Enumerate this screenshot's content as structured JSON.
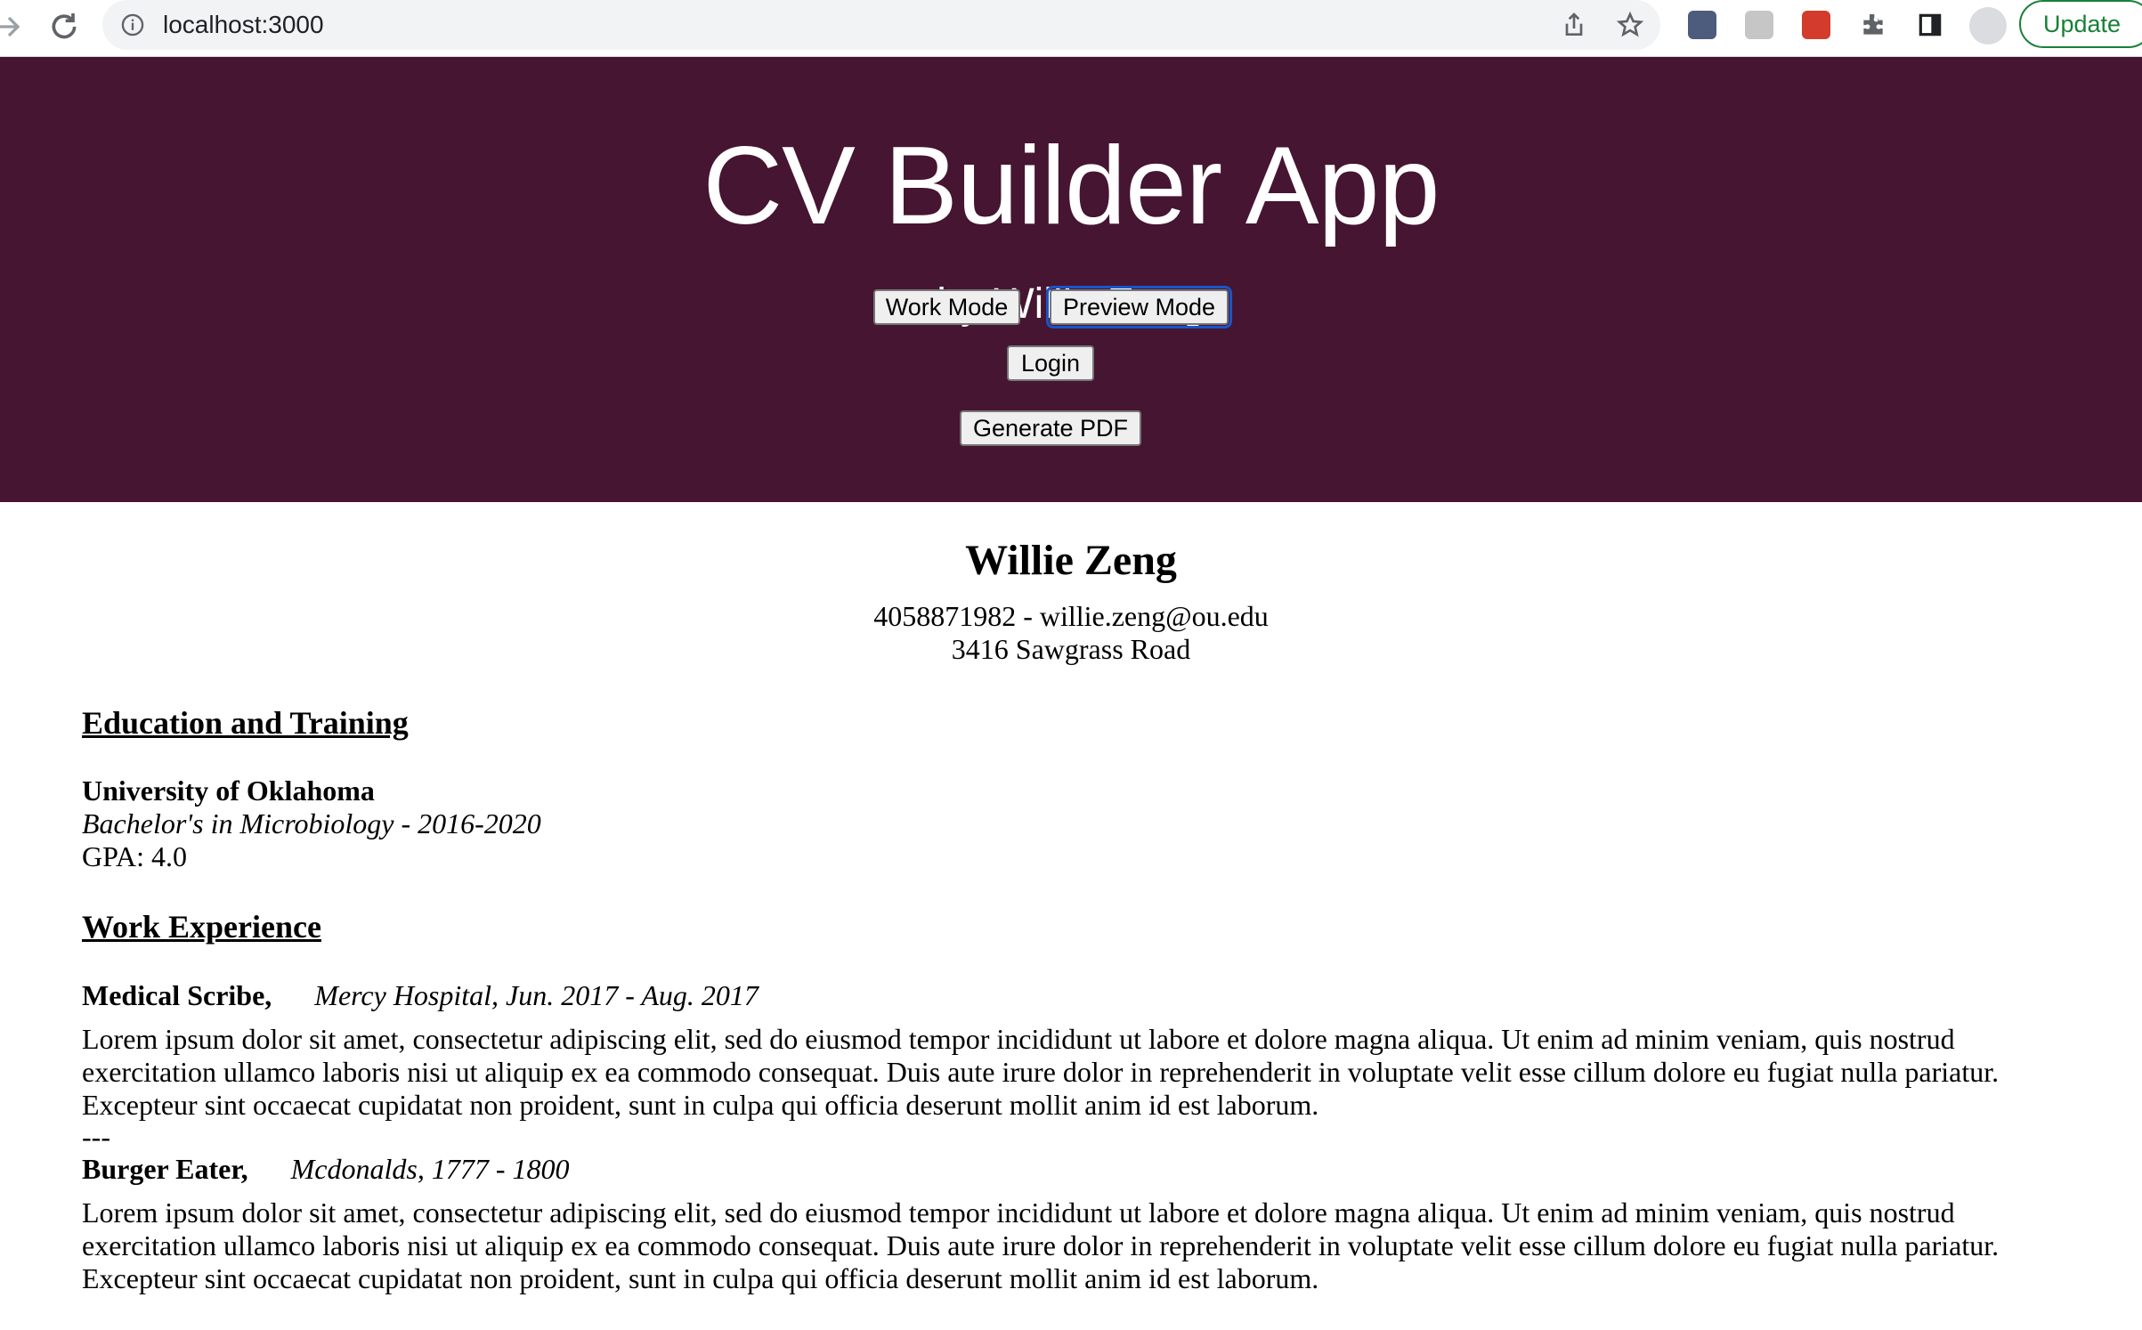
{
  "browser": {
    "url": "localhost:3000",
    "update_label": "Update",
    "accent": "#188038"
  },
  "app": {
    "header_color": "#461531",
    "title": "CV Builder App",
    "subtitle": "by Willie Zeng",
    "buttons": {
      "work_mode": "Work Mode",
      "preview_mode": "Preview Mode",
      "login": "Login",
      "generate_pdf": "Generate PDF"
    }
  },
  "resume": {
    "name": "Willie Zeng",
    "contact_line": "4058871982 - willie.zeng@ou.edu",
    "address": "3416 Sawgrass Road",
    "education": {
      "heading": "Education and Training",
      "school": "University of Oklahoma",
      "degree": "Bachelor's in Microbiology - 2016-2020",
      "gpa": "GPA: 4.0"
    },
    "work": {
      "heading": "Work Experience",
      "jobs": [
        {
          "title": "Medical Scribe,",
          "details": "Mercy Hospital, Jun. 2017 - Aug. 2017",
          "description": "Lorem ipsum dolor sit amet, consectetur adipiscing elit, sed do eiusmod tempor incididunt ut labore et dolore magna aliqua. Ut enim ad minim veniam, quis nostrud exercitation ullamco laboris nisi ut aliquip ex ea commodo consequat. Duis aute irure dolor in reprehenderit in voluptate velit esse cillum dolore eu fugiat nulla pariatur. Excepteur sint occaecat cupidatat non proident, sunt in culpa qui officia deserunt mollit anim id est laborum."
        },
        {
          "title": "Burger Eater,",
          "details": "Mcdonalds, 1777 - 1800",
          "description": "Lorem ipsum dolor sit amet, consectetur adipiscing elit, sed do eiusmod tempor incididunt ut labore et dolore magna aliqua. Ut enim ad minim veniam, quis nostrud exercitation ullamco laboris nisi ut aliquip ex ea commodo consequat. Duis aute irure dolor in reprehenderit in voluptate velit esse cillum dolore eu fugiat nulla pariatur. Excepteur sint occaecat cupidatat non proident, sunt in culpa qui officia deserunt mollit anim id est laborum."
        }
      ],
      "separator": "---"
    }
  }
}
